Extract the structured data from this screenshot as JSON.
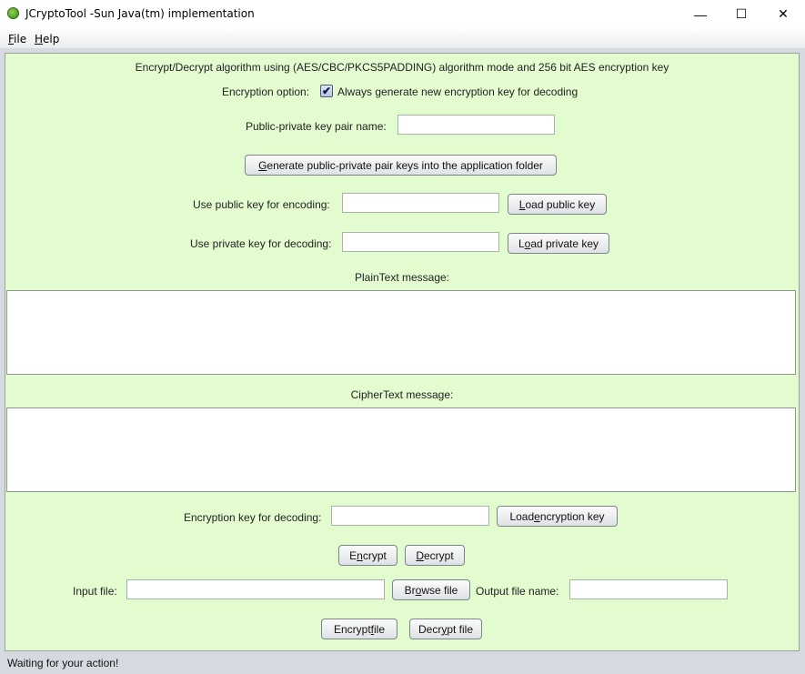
{
  "window": {
    "title": "JCryptoTool -Sun Java(tm) implementation",
    "app_icon": "java-app-icon",
    "controls": {
      "minimize": "—",
      "maximize": "☐",
      "close": "✕"
    }
  },
  "menu": {
    "items": [
      {
        "label": "File",
        "mnemonic": "F"
      },
      {
        "label": "Help",
        "mnemonic": "H"
      }
    ]
  },
  "main": {
    "header": "Encrypt/Decrypt algorithm using (AES/CBC/PKCS5PADDING) algorithm mode and 256 bit AES encryption key",
    "encryption_option": {
      "label": "Encryption option:",
      "checkbox_label": "Always generate new encryption key for decoding",
      "checked": true,
      "check_glyph": "✔"
    },
    "key_pair_name": {
      "label": "Public-private key pair name:",
      "value": ""
    },
    "generate_button": {
      "label_pre": "",
      "mnemonic": "G",
      "label_post": "enerate public-private pair keys into the application folder"
    },
    "public_key": {
      "label": "Use public key for encoding:",
      "value": "",
      "button_mnemonic": "L",
      "button_rest": "oad public key"
    },
    "private_key": {
      "label": "Use private key for decoding:",
      "value": "",
      "button_pre": "L",
      "button_mnemonic": "o",
      "button_rest": "ad private key"
    },
    "plaintext": {
      "label": "PlainText message:",
      "value": ""
    },
    "ciphertext": {
      "label": "CipherText message:",
      "value": ""
    },
    "encryption_key": {
      "label": "Encryption key for decoding:",
      "value": "",
      "button_pre": "Load ",
      "button_mnemonic": "e",
      "button_rest": "ncryption key"
    },
    "encrypt_button": {
      "pre": "E",
      "mnemonic": "n",
      "rest": "crypt"
    },
    "decrypt_button": {
      "pre": "",
      "mnemonic": "D",
      "rest": "ecrypt"
    },
    "input_file": {
      "label": "Input file:",
      "value": ""
    },
    "browse_button": {
      "pre": "Br",
      "mnemonic": "o",
      "rest": "wse file"
    },
    "output_file": {
      "label": "Output file name:",
      "value": ""
    },
    "encrypt_file_button": {
      "pre": "Encrypt ",
      "mnemonic": "f",
      "rest": "ile"
    },
    "decrypt_file_button": {
      "pre": "Decr",
      "mnemonic": "y",
      "rest": "pt file"
    }
  },
  "status": {
    "text": "Waiting for your action!"
  }
}
